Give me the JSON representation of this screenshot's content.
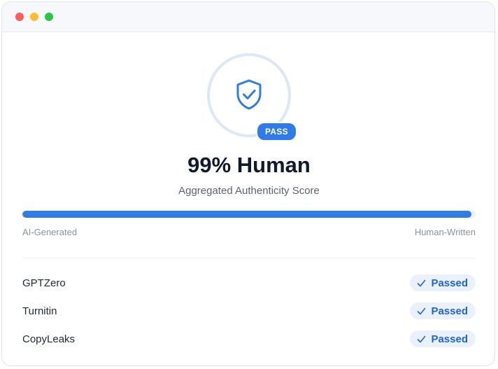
{
  "window": {
    "controls": [
      "close",
      "minimize",
      "maximize"
    ],
    "control_colors": {
      "close": "#ff5f57",
      "minimize": "#febc2e",
      "maximize": "#28c840"
    }
  },
  "badge": {
    "icon": "shield-check-icon",
    "label": "PASS"
  },
  "result": {
    "score_text": "99% Human",
    "score_percent": 99,
    "subtitle": "Aggregated Authenticity Score"
  },
  "scale": {
    "left_label": "AI-Generated",
    "right_label": "Human-Written"
  },
  "detectors": [
    {
      "name": "GPTZero",
      "status": "Passed"
    },
    {
      "name": "Turnitin",
      "status": "Passed"
    },
    {
      "name": "CopyLeaks",
      "status": "Passed"
    }
  ],
  "colors": {
    "accent": "#2f7bea",
    "status_text": "#1f63d6",
    "ring": "#dce7f8"
  }
}
